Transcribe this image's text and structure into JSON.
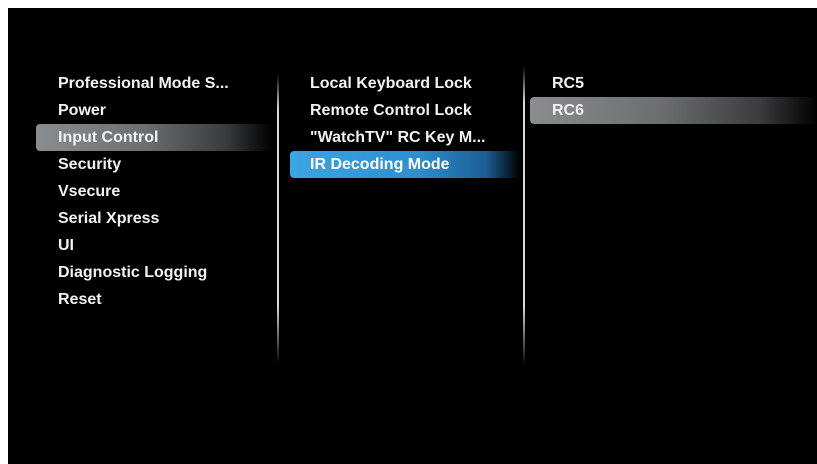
{
  "columns": {
    "main": {
      "items": [
        {
          "label": "Professional Mode S..."
        },
        {
          "label": "Power"
        },
        {
          "label": "Input Control"
        },
        {
          "label": "Security"
        },
        {
          "label": "Vsecure"
        },
        {
          "label": "Serial Xpress"
        },
        {
          "label": "UI"
        },
        {
          "label": "Diagnostic Logging"
        },
        {
          "label": "Reset"
        }
      ],
      "selected_index": 2
    },
    "submenu": {
      "items": [
        {
          "label": "Local Keyboard Lock"
        },
        {
          "label": "Remote Control Lock"
        },
        {
          "label": "\"WatchTV\" RC Key M..."
        },
        {
          "label": "IR Decoding Mode"
        }
      ],
      "focused_index": 3
    },
    "options": {
      "items": [
        {
          "label": "RC5"
        },
        {
          "label": "RC6"
        }
      ],
      "selected_index": 1
    }
  },
  "colors": {
    "background": "#000000",
    "text": "#f2f2f2",
    "selection_gray": "#8a8d8e",
    "focus_blue": "#3aa6e3"
  }
}
